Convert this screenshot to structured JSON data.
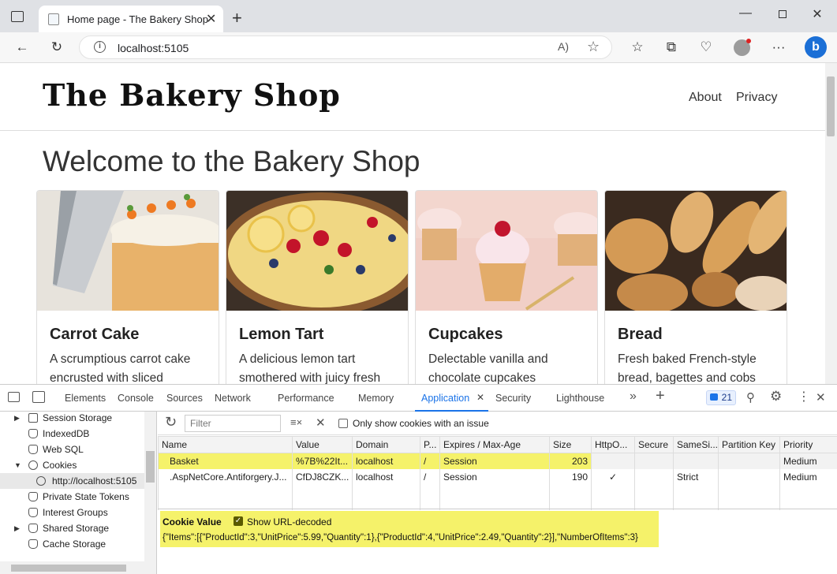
{
  "browser": {
    "tab_title": "Home page - The Bakery Shop",
    "url": "localhost:5105"
  },
  "site": {
    "brand": "The Bakery Shop",
    "nav": [
      "About",
      "Privacy"
    ],
    "heading": "Welcome to the Bakery Shop",
    "cards": [
      {
        "title": "Carrot Cake",
        "line1": "A scrumptious carrot cake",
        "line2": "encrusted with sliced"
      },
      {
        "title": "Lemon Tart",
        "line1": "A delicious lemon tart",
        "line2": "smothered with juicy fresh"
      },
      {
        "title": "Cupcakes",
        "line1": "Delectable vanilla and",
        "line2": "chocolate cupcakes"
      },
      {
        "title": "Bread",
        "line1": "Fresh baked French-style",
        "line2": "bread, bagettes and cobs"
      }
    ]
  },
  "devtools": {
    "tabs": [
      "Elements",
      "Console",
      "Sources",
      "Network",
      "Performance",
      "Memory",
      "Application",
      "Security",
      "Lighthouse"
    ],
    "issues_count": "21",
    "tree": [
      "Session Storage",
      "IndexedDB",
      "Web SQL",
      "Cookies",
      "http://localhost:5105",
      "Private State Tokens",
      "Interest Groups",
      "Shared Storage",
      "Cache Storage"
    ],
    "filter_placeholder": "Filter",
    "only_issue_label": "Only show cookies with an issue",
    "columns": [
      "Name",
      "Value",
      "Domain",
      "P...",
      "Expires / Max-Age",
      "Size",
      "HttpO...",
      "Secure",
      "SameSi...",
      "Partition Key",
      "Priority"
    ],
    "rows": [
      [
        "Basket",
        "%7B%22It...",
        "localhost",
        "/",
        "Session",
        "203",
        "",
        "",
        "",
        "",
        "Medium"
      ],
      [
        ".AspNetCore.Antiforgery.J...",
        "CfDJ8CZK...",
        "localhost",
        "/",
        "Session",
        "190",
        "✓",
        "",
        "Strict",
        "",
        "Medium"
      ]
    ],
    "cookie_value_label": "Cookie Value",
    "show_decoded_label": "Show URL-decoded",
    "cookie_value": "{\"Items\":[{\"ProductId\":3,\"UnitPrice\":5.99,\"Quantity\":1},{\"ProductId\":4,\"UnitPrice\":2.49,\"Quantity\":2}],\"NumberOfItems\":3}",
    "highlight_color": "#f5f26a"
  }
}
